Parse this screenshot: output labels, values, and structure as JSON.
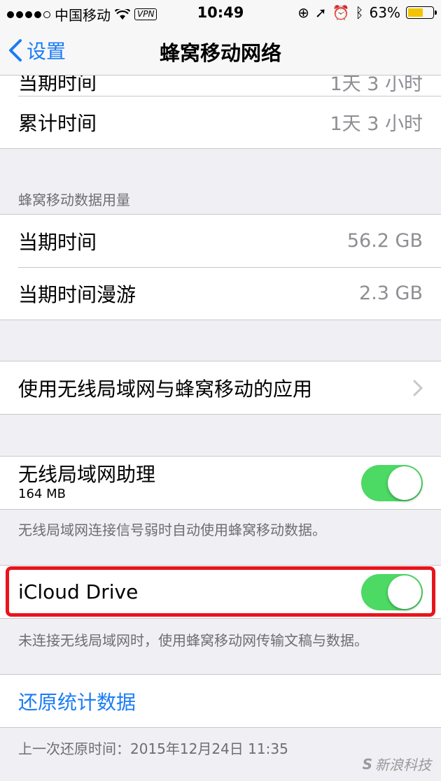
{
  "status_bar": {
    "carrier": "中国移动",
    "vpn": "VPN",
    "time": "10:49",
    "battery": "63%",
    "battery_level": 0.63
  },
  "nav": {
    "back_label": "设置",
    "title": "蜂窝移动网络"
  },
  "top_group": {
    "partial_label": "当期时间",
    "partial_value": "1天 3 小时",
    "rows": [
      {
        "label": "累计时间",
        "value": "1天 3 小时"
      }
    ]
  },
  "data_usage": {
    "header": "蜂窝移动数据用量",
    "rows": [
      {
        "label": "当期时间",
        "value": "56.2 GB"
      },
      {
        "label": "当期时间漫游",
        "value": "2.3 GB"
      }
    ]
  },
  "apps_row": {
    "label": "使用无线局域网与蜂窝移动的应用"
  },
  "wifi_assist": {
    "label": "无线局域网助理",
    "sub": "164 MB",
    "on": true,
    "footer": "无线局域网连接信号弱时自动使用蜂窝移动数据。"
  },
  "icloud": {
    "label": "iCloud Drive",
    "on": true,
    "footer": "未连接无线局域网时，使用蜂窝移动网传输文稿与数据。"
  },
  "reset": {
    "label": "还原统计数据",
    "footer": "上一次还原时间：2015年12月24日 11:35"
  },
  "watermark": "新浪科技",
  "colors": {
    "accent": "#1a7cf5",
    "toggle_on": "#4cd964",
    "highlight": "#e8141c"
  }
}
